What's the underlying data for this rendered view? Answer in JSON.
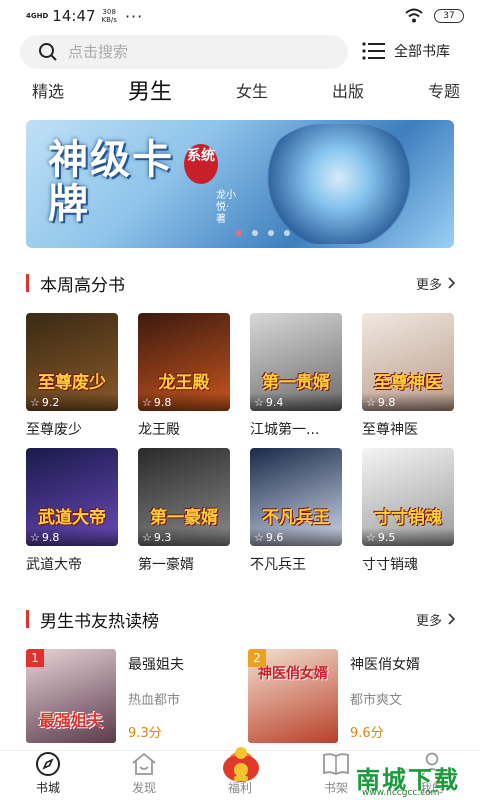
{
  "status_bar": {
    "network": "4GHD",
    "time": "14:47",
    "speed": "308",
    "speed_unit": "KB/s",
    "more": "···",
    "battery": "37"
  },
  "search": {
    "placeholder": "点击搜索",
    "library_label": "全部书库"
  },
  "tabs": [
    {
      "label": "精选",
      "active": false
    },
    {
      "label": "男生",
      "active": true
    },
    {
      "label": "女生",
      "active": false
    },
    {
      "label": "出版",
      "active": false
    },
    {
      "label": "专题",
      "active": false
    }
  ],
  "banner": {
    "title": "神级卡牌",
    "tag": "系统",
    "author": "龙小悦·著"
  },
  "weekly": {
    "title": "本周高分书",
    "more": "更多",
    "books": [
      {
        "title": "至尊废少",
        "cover_text": "至尊废少",
        "rating": "9.2",
        "colors": [
          "#3a2a14",
          "#8a5a2a"
        ]
      },
      {
        "title": "龙王殿",
        "cover_text": "龙王殿",
        "rating": "9.8",
        "colors": [
          "#3d1a10",
          "#c8561e"
        ]
      },
      {
        "title": "江城第一...",
        "cover_text": "第一贵婿",
        "rating": "9.4",
        "colors": [
          "#d8d8d8",
          "#6a6a6a"
        ]
      },
      {
        "title": "至尊神医",
        "cover_text": "至尊神医",
        "rating": "9.8",
        "colors": [
          "#f0e8e0",
          "#b89a8a"
        ]
      },
      {
        "title": "武道大帝",
        "cover_text": "武道大帝",
        "rating": "9.8",
        "colors": [
          "#1a1a4a",
          "#6a4ab8"
        ]
      },
      {
        "title": "第一豪婿",
        "cover_text": "第一豪婿",
        "rating": "9.3",
        "colors": [
          "#2a2a2a",
          "#8a8a8a"
        ]
      },
      {
        "title": "不凡兵王",
        "cover_text": "不凡兵王",
        "rating": "9.6",
        "colors": [
          "#1a2a4a",
          "#d0d8e8"
        ]
      },
      {
        "title": "寸寸销魂",
        "cover_text": "寸寸销魂",
        "rating": "9.5",
        "colors": [
          "#f4f4f4",
          "#9a9a9a"
        ]
      }
    ]
  },
  "hot": {
    "title": "男生书友热读榜",
    "more": "更多",
    "items": [
      {
        "rank": "1",
        "title": "最强姐夫",
        "category": "热血都市",
        "score": "9.3分",
        "cover_text": "最强姐夫",
        "badge_color": "#e0312f",
        "colors": [
          "#e8d4d8",
          "#5a3a4a"
        ]
      },
      {
        "rank": "2",
        "title": "神医俏女婿",
        "category": "都市爽文",
        "score": "9.6分",
        "cover_text": "神医俏女婿",
        "badge_color": "#f0a020",
        "colors": [
          "#f4e0d0",
          "#b8402a"
        ]
      }
    ]
  },
  "nav": [
    {
      "label": "书城",
      "icon": "compass-icon",
      "active": true
    },
    {
      "label": "发现",
      "icon": "home-icon",
      "active": false
    },
    {
      "label": "福利",
      "icon": "gift-bag-icon",
      "active": false
    },
    {
      "label": "书架",
      "icon": "book-icon",
      "active": false
    },
    {
      "label": "我的",
      "icon": "user-icon",
      "active": false
    }
  ],
  "watermark": {
    "main": "南城下载",
    "sub": "www.nccgcc.com"
  },
  "colors": {
    "accent": "#e0312f",
    "score": "#e0860a"
  }
}
